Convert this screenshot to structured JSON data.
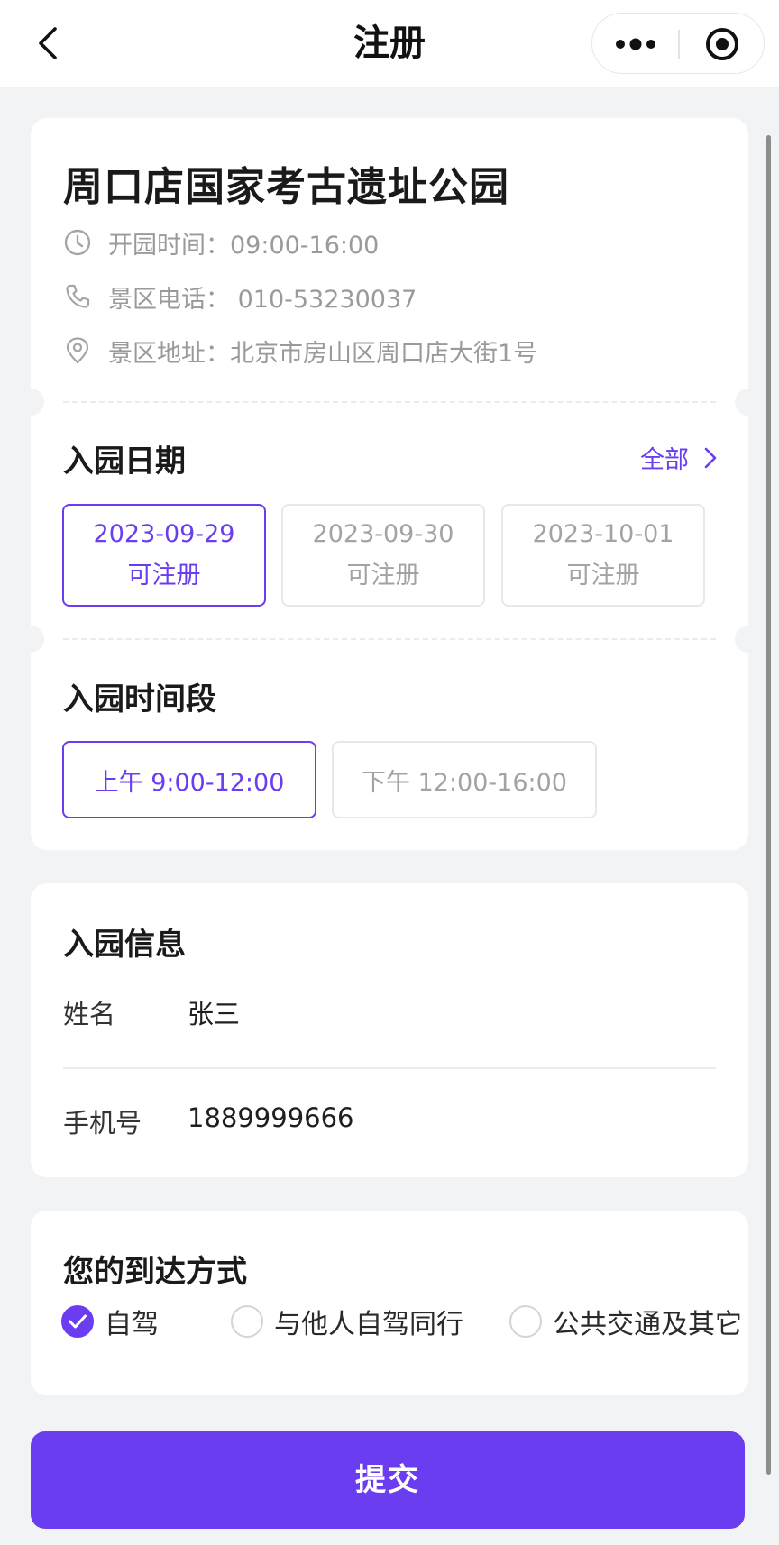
{
  "nav": {
    "title": "注册"
  },
  "park": {
    "name": "周口店国家考古遗址公园",
    "hours": "开园时间：09:00-16:00",
    "phone": "景区电话： 010-53230037",
    "address": "景区地址：北京市房山区周口店大街1号"
  },
  "entry_date": {
    "title": "入园日期",
    "all_label": "全部",
    "dates": [
      {
        "date": "2023-09-29",
        "status": "可注册",
        "selected": true
      },
      {
        "date": "2023-09-30",
        "status": "可注册",
        "selected": false
      },
      {
        "date": "2023-10-01",
        "status": "可注册",
        "selected": false
      }
    ]
  },
  "time_slot": {
    "title": "入园时间段",
    "slots": [
      {
        "label": "上午 9:00-12:00",
        "selected": true
      },
      {
        "label": "下午 12:00-16:00",
        "selected": false
      }
    ]
  },
  "visitor": {
    "title": "入园信息",
    "name_label": "姓名",
    "name_value": "张三",
    "phone_label": "手机号",
    "phone_value": "1889999666"
  },
  "arrival": {
    "title": "您的到达方式",
    "options": [
      {
        "label": "自驾",
        "checked": true
      },
      {
        "label": "与他人自驾同行",
        "checked": false
      },
      {
        "label": "公共交通及其它",
        "checked": false
      }
    ]
  },
  "submit_label": "提交",
  "colors": {
    "accent": "#6a3df0",
    "muted_text": "#9a9a9a",
    "background": "#f2f3f5"
  },
  "icons": [
    "back-arrow-icon",
    "more-dots-icon",
    "target-circle-icon",
    "clock-icon",
    "phone-icon",
    "location-pin-icon",
    "chevron-right-icon",
    "check-icon"
  ]
}
